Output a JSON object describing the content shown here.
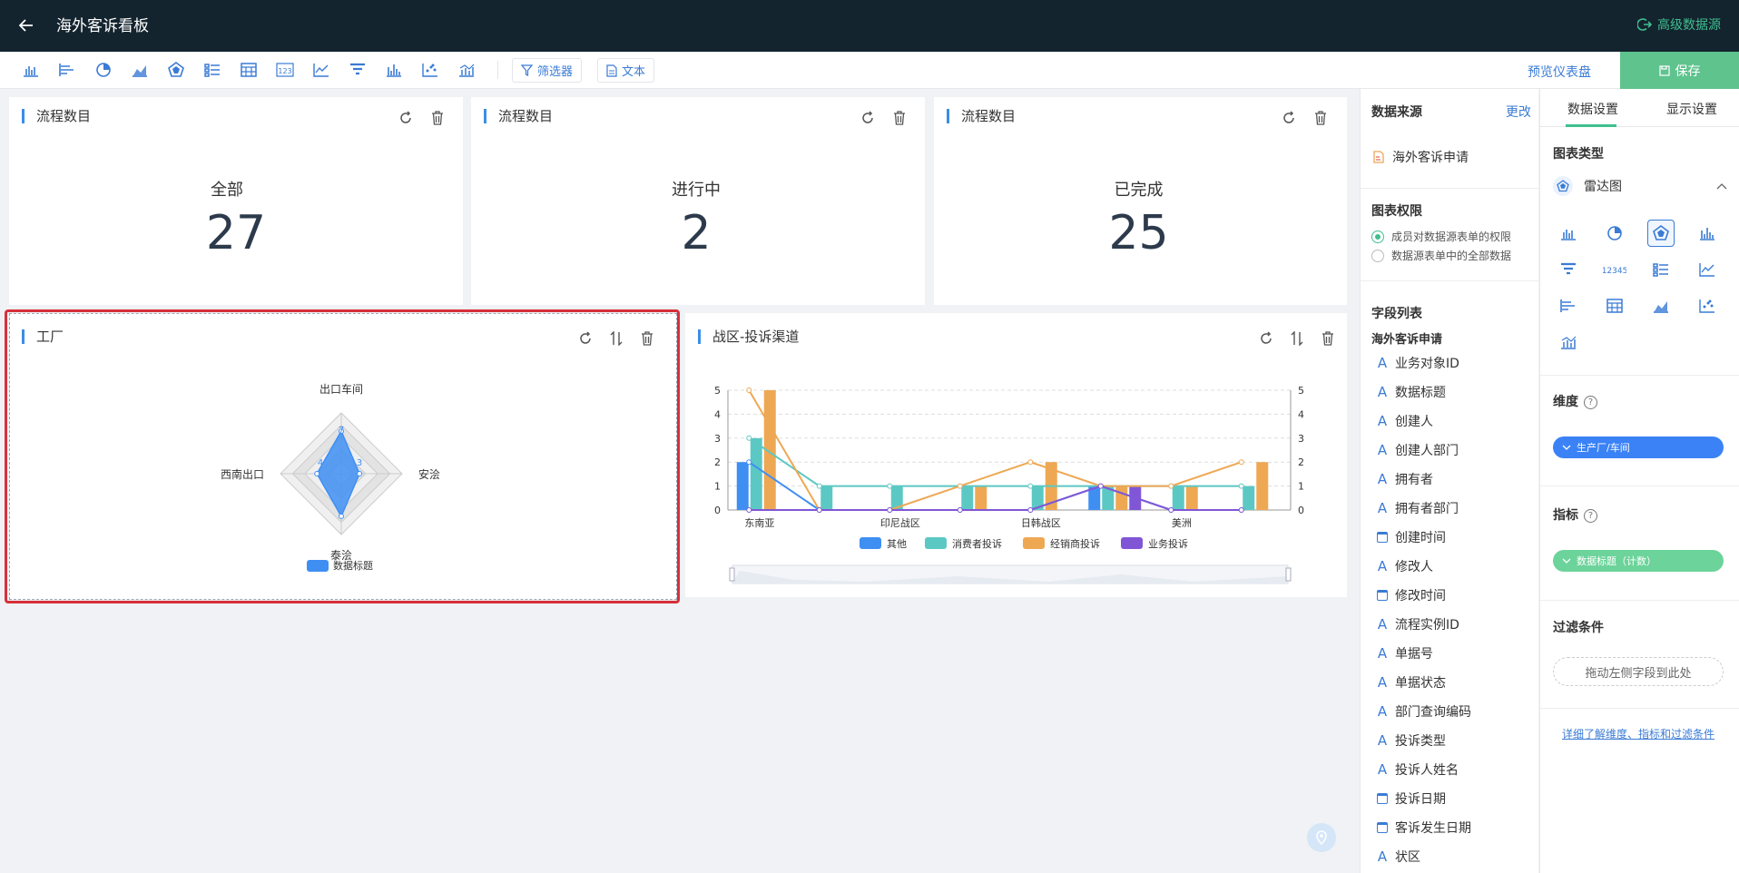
{
  "header": {
    "title": "海外客诉看板",
    "adv_source": "高级数据源"
  },
  "toolbar": {
    "filter_label": "筛选器",
    "text_label": "文本",
    "preview_label": "预览仪表盘",
    "save_label": "保存"
  },
  "kpis": [
    {
      "title": "流程数目",
      "label": "全部",
      "value": "27"
    },
    {
      "title": "流程数目",
      "label": "进行中",
      "value": "2"
    },
    {
      "title": "流程数目",
      "label": "已完成",
      "value": "25"
    }
  ],
  "radar_card": {
    "title": "工厂"
  },
  "combo_card": {
    "title": "战区-投诉渠道"
  },
  "colors": {
    "accent": "#3a8ee6",
    "selected_border": "#d6303a",
    "save": "#5fc38e",
    "topbar": "#14242f"
  },
  "chart_data": [
    {
      "type": "radar",
      "indicators": [
        "出口车间",
        "安浍",
        "泰浍",
        "西南出口"
      ],
      "series": [
        {
          "name": "数据标题",
          "values": [
            7,
            3,
            7,
            4
          ]
        }
      ],
      "value_labels": [
        "7",
        "3",
        "4"
      ],
      "max": 10,
      "legend_position": "bottom"
    },
    {
      "type": "bar+line",
      "x_tick_labels": [
        "东南亚",
        "印尼战区",
        "日韩战区",
        "美洲"
      ],
      "y_ticks": [
        "0",
        "1",
        "2",
        "3",
        "4",
        "5"
      ],
      "y2_ticks": [
        "0",
        "1",
        "2",
        "3",
        "4",
        "5"
      ],
      "ylim": [
        0,
        5
      ],
      "categories_count": 8,
      "series": [
        {
          "name": "其他",
          "color": "#3f8ff3",
          "bars": [
            2,
            0,
            0,
            0,
            0,
            1,
            0,
            0
          ],
          "line": [
            2,
            0,
            0,
            0,
            0,
            1,
            0,
            0
          ]
        },
        {
          "name": "消费者投诉",
          "color": "#5cc8c4",
          "bars": [
            3,
            1,
            1,
            1,
            1,
            1,
            1,
            1
          ],
          "line": [
            3,
            1,
            1,
            1,
            1,
            1,
            1,
            1
          ]
        },
        {
          "name": "经销商投诉",
          "color": "#eea853",
          "bars": [
            5,
            0,
            0,
            1,
            2,
            1,
            1,
            2
          ],
          "line": [
            5,
            0,
            0,
            1,
            2,
            1,
            1,
            2
          ]
        },
        {
          "name": "业务投诉",
          "color": "#8156d6",
          "bars": [
            0,
            0,
            0,
            0,
            0,
            1,
            0,
            0
          ],
          "line": [
            0,
            0,
            0,
            0,
            0,
            1,
            0,
            0
          ]
        }
      ],
      "legend_position": "bottom",
      "grid": true
    }
  ],
  "mid_panel": {
    "source_title": "数据来源",
    "source_change": "更改",
    "source_name": "海外客诉申请",
    "perm_title": "图表权限",
    "perm_opt1": "成员对数据源表单的权限",
    "perm_opt2": "数据源表单中的全部数据",
    "fields_title": "字段列表",
    "fields_group": "海外客诉申请",
    "fields": [
      {
        "label": "业务对象ID",
        "type": "text"
      },
      {
        "label": "数据标题",
        "type": "text"
      },
      {
        "label": "创建人",
        "type": "text"
      },
      {
        "label": "创建人部门",
        "type": "text"
      },
      {
        "label": "拥有者",
        "type": "text"
      },
      {
        "label": "拥有者部门",
        "type": "text"
      },
      {
        "label": "创建时间",
        "type": "date"
      },
      {
        "label": "修改人",
        "type": "text"
      },
      {
        "label": "修改时间",
        "type": "date"
      },
      {
        "label": "流程实例ID",
        "type": "text"
      },
      {
        "label": "单据号",
        "type": "text"
      },
      {
        "label": "单据状态",
        "type": "text"
      },
      {
        "label": "部门查询编码",
        "type": "text"
      },
      {
        "label": "投诉类型",
        "type": "text"
      },
      {
        "label": "投诉人姓名",
        "type": "text"
      },
      {
        "label": "投诉日期",
        "type": "date"
      },
      {
        "label": "客诉发生日期",
        "type": "date"
      },
      {
        "label": "状区",
        "type": "text"
      }
    ]
  },
  "right_panel": {
    "tab_data": "数据设置",
    "tab_display": "显示设置",
    "chart_type_title": "图表类型",
    "chart_type_selected": "雷达图",
    "dimension_title": "维度",
    "dimension_value": "生产厂/车间",
    "metric_title": "指标",
    "metric_value": "数据标题（计数）",
    "filter_title": "过滤条件",
    "filter_drop": "拖动左侧字段到此处",
    "help_link": "详细了解维度、指标和过滤条件"
  }
}
